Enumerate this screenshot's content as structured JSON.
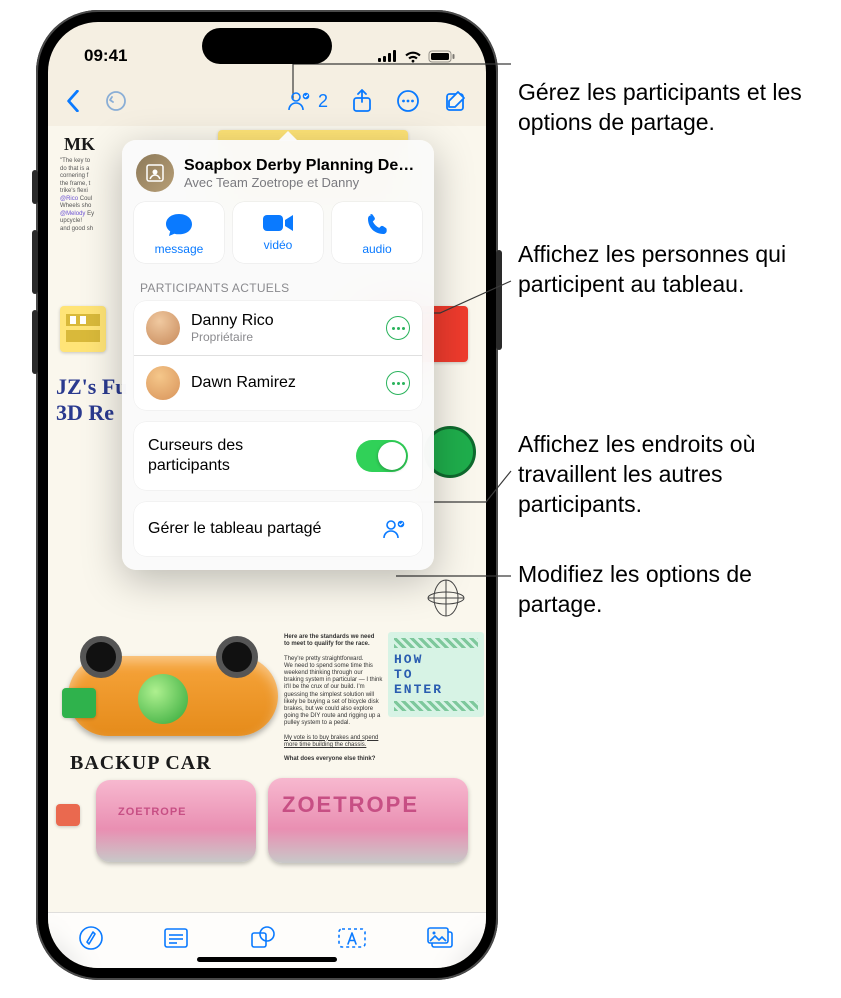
{
  "status": {
    "time": "09:41"
  },
  "toolbar": {
    "collab_count": "2"
  },
  "popover": {
    "title": "Soapbox Derby Planning De…",
    "subtitle": "Avec Team Zoetrope et Danny",
    "comm": {
      "message": "message",
      "video": "vidéo",
      "audio": "audio"
    },
    "participants_header": "PARTICIPANTS ACTUELS",
    "participants": [
      {
        "name": "Danny Rico",
        "role": "Propriétaire"
      },
      {
        "name": "Dawn Ramirez",
        "role": ""
      }
    ],
    "cursors_label": "Curseurs des participants",
    "cursors_on": true,
    "manage_label": "Gérer le tableau partagé"
  },
  "canvas": {
    "handwriting_left": "JZ's Fu\n3D Re",
    "backup_label": "BACKUP CAR",
    "howto_lines": [
      "HOW",
      "TO",
      "ENTER"
    ],
    "mk": "MK"
  },
  "callouts": {
    "c1": "Gérez les participants et les options de partage.",
    "c2": "Affichez les personnes qui participent au tableau.",
    "c3": "Affichez les endroits où travaillent les autres participants.",
    "c4": "Modifiez les options de partage."
  }
}
